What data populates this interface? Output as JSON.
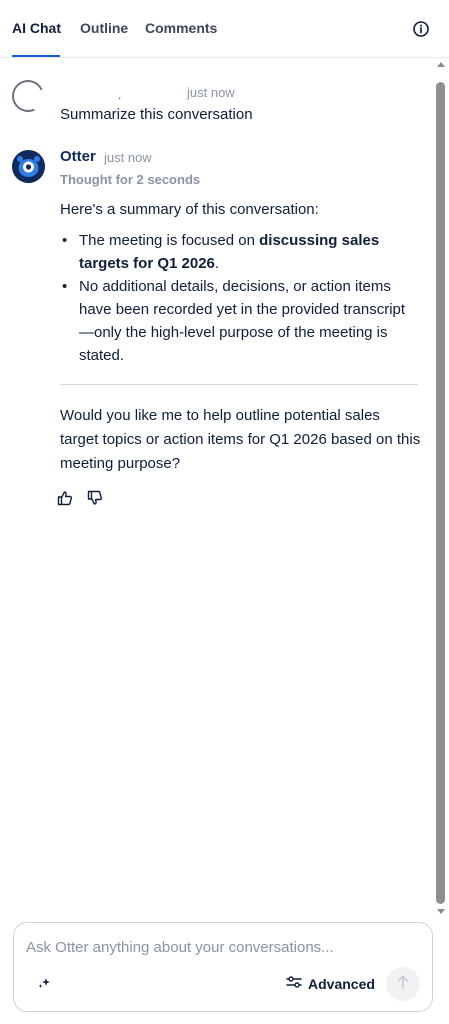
{
  "tabs": [
    {
      "label": "AI Chat",
      "active": true
    },
    {
      "label": "Outline",
      "active": false
    },
    {
      "label": "Comments",
      "active": false
    }
  ],
  "icons": {
    "info": "info-icon",
    "thumbs_up": "thumbs-up-icon",
    "thumbs_down": "thumbs-down-icon",
    "sparkle": "sparkle-icon",
    "sliders": "sliders-icon",
    "send": "arrow-up-icon"
  },
  "colors": {
    "accent": "#1a5bd6",
    "brand_navy": "#0f2a5c",
    "muted": "#8a94a6"
  },
  "user_message": {
    "name_placeholder": ".",
    "time": "just now",
    "text": "Summarize this conversation"
  },
  "otter_message": {
    "name": "Otter",
    "time": "just now",
    "thought": "Thought for 2 seconds",
    "intro": "Here's a summary of this conversation:",
    "bullet1_pre": "The meeting is focused on ",
    "bullet1_bold": "discussing sales targets for Q1 2026",
    "bullet1_post": ".",
    "bullet2": "No additional details, decisions, or action items have been recorded yet in the provided transcript—only the high-level purpose of the meeting is stated.",
    "followup": "Would you like me to help outline potential sales target topics or action items for Q1 2026 based on this meeting purpose?"
  },
  "composer": {
    "placeholder": "Ask Otter anything about your conversations...",
    "advanced_label": "Advanced"
  }
}
